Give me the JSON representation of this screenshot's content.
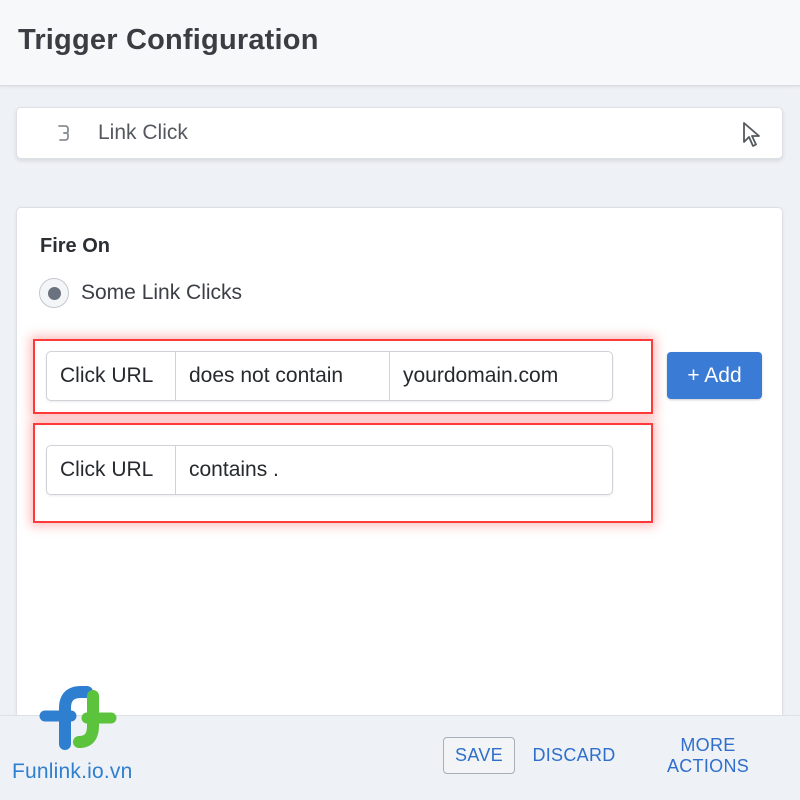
{
  "header": {
    "title": "Trigger Configuration"
  },
  "trigger_type": {
    "icon": "link-icon",
    "label": "Link Click",
    "select_icon": "cursor-pointer-icon"
  },
  "config": {
    "heading": "Fire On",
    "radio_option": {
      "label": "Some Link Clicks",
      "selected": true
    },
    "rules": [
      {
        "variable": "Click URL",
        "operator": "does not contain",
        "value": "yourdomain.com"
      },
      {
        "variable": "Click URL",
        "operator": "contains ."
      }
    ],
    "add_button": "+ Add"
  },
  "footer": {
    "save": "SAVE",
    "discard": "DISCARD",
    "more_actions": "MORE ACTIONS"
  },
  "brand": {
    "text": "Funlink.io.vn",
    "logo_text": "fl",
    "colors": {
      "blue": "#2f7fd0",
      "green": "#5cc43c"
    }
  },
  "colors": {
    "accent": "#3a7bd5",
    "highlight": "#ff3a3a",
    "link_text": "#2f6fcb"
  }
}
